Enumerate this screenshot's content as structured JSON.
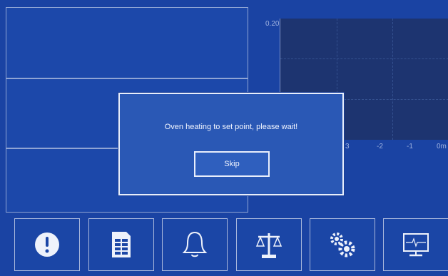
{
  "chart": {
    "y_top_label": "0.20",
    "x_ticks": [
      "3",
      "-2",
      "-1",
      "0m"
    ]
  },
  "modal": {
    "message": "Oven heating to set point, please wait!",
    "skip_label": "Skip"
  },
  "toolbar": {
    "buttons": [
      {
        "name": "alert",
        "icon": "exclamation-circle-icon"
      },
      {
        "name": "report",
        "icon": "document-icon"
      },
      {
        "name": "alarm",
        "icon": "bell-icon"
      },
      {
        "name": "balance",
        "icon": "scale-icon"
      },
      {
        "name": "settings",
        "icon": "gears-icon"
      },
      {
        "name": "monitor",
        "icon": "monitor-icon"
      }
    ]
  },
  "colors": {
    "background": "#1a43a3",
    "modal_bg": "#2a58b5",
    "border": "#e8eefc",
    "chart_bg": "#1d3470"
  }
}
